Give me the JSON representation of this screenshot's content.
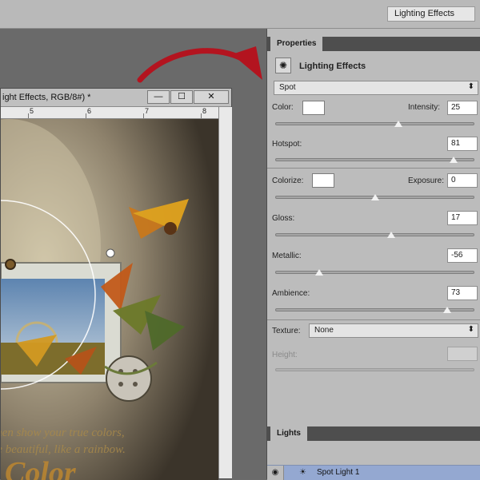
{
  "topbar": {
    "preset_label": "Lighting Effects"
  },
  "document": {
    "title": "ight Effects, RGB/8#) *",
    "ruler_ticks": [
      "5",
      "6",
      "7",
      "8"
    ],
    "buttons": {
      "minimize": "—",
      "maximize": "☐",
      "close": "✕"
    },
    "canvas_text": {
      "line1": "then show your true colors,",
      "line2": "re beautiful, like a rainbow.",
      "line3": "Color"
    }
  },
  "properties": {
    "tab_label": "Properties",
    "title": "Lighting Effects",
    "light_type": "Spot",
    "color_label": "Color:",
    "intensity_label": "Intensity:",
    "intensity_value": "25",
    "intensity_level": 0.62,
    "hotspot_label": "Hotspot:",
    "hotspot_value": "81",
    "hotspot_level": 0.9,
    "colorize_label": "Colorize:",
    "exposure_label": "Exposure:",
    "exposure_value": "0",
    "exposure_level": 0.5,
    "gloss_label": "Gloss:",
    "gloss_value": "17",
    "gloss_level": 0.585,
    "metallic_label": "Metallic:",
    "metallic_value": "-56",
    "metallic_level": 0.22,
    "ambience_label": "Ambience:",
    "ambience_value": "73",
    "ambience_level": 0.865,
    "texture_label": "Texture:",
    "texture_value": "None",
    "height_label": "Height:"
  },
  "lights": {
    "tab_label": "Lights",
    "items": [
      {
        "name": "Spot Light 1"
      }
    ]
  },
  "colors": {
    "panel_bg": "#bcbcbc",
    "selection": "#94a8d1",
    "arrow": "#b3141f"
  },
  "icons": {
    "lighting": "sun-icon",
    "eye": "eye-icon",
    "bulb": "bulb-icon"
  }
}
